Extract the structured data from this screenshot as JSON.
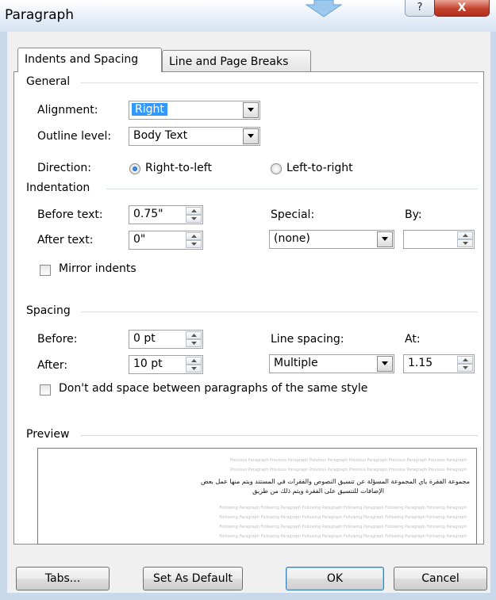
{
  "window": {
    "title": "Paragraph",
    "help_glyph": "?",
    "close_glyph": "X"
  },
  "tabs": [
    {
      "label": "Indents and Spacing",
      "mnemonic": "I",
      "active": true
    },
    {
      "label": "Line and Page Breaks",
      "mnemonic": "P",
      "active": false
    }
  ],
  "general": {
    "title": "General",
    "alignment": {
      "label": "Alignment:",
      "value": "Right"
    },
    "outline": {
      "label": "Outline level:",
      "value": "Body Text"
    },
    "direction": {
      "label": "Direction:",
      "options": [
        {
          "label": "Right-to-left",
          "selected": true
        },
        {
          "label": "Left-to-right",
          "selected": false
        }
      ]
    }
  },
  "indentation": {
    "title": "Indentation",
    "before_text": {
      "label": "Before text:",
      "value": "0.75\""
    },
    "after_text": {
      "label": "After text:",
      "value": "0\""
    },
    "special": {
      "label": "Special:",
      "value": "(none)"
    },
    "by": {
      "label": "By:",
      "value": ""
    },
    "mirror": {
      "label": "Mirror indents",
      "checked": false
    }
  },
  "spacing": {
    "title": "Spacing",
    "before": {
      "label": "Before:",
      "value": "0 pt"
    },
    "after": {
      "label": "After:",
      "value": "10 pt"
    },
    "line_spacing": {
      "label": "Line spacing:",
      "value": "Multiple"
    },
    "at": {
      "label": "At:",
      "value": "1.15"
    },
    "dont_add": {
      "label": "Don't add space between paragraphs of the same style",
      "checked": false
    }
  },
  "preview": {
    "title": "Preview",
    "sample_gray": "Previous Paragraph Previous Paragraph Previous Paragraph Previous Paragraph Previous Paragraph Previous Paragraph",
    "sample_arabic_1": "مجموعة الفقرة ياي المجموعة المسؤلة عن تنسيق النصوص والفقرات في المستند ويتم منها عمل بعض",
    "sample_arabic_2": "الإضافات للتنسيق على الفقرة ويتم ذلك من طريق",
    "sample_following": "Following Paragraph Following Paragraph Following Paragraph Following Paragraph Following Paragraph Following Paragraph"
  },
  "buttons": {
    "tabs": "Tabs...",
    "set_default": "Set As Default",
    "ok": "OK",
    "cancel": "Cancel"
  },
  "colors": {
    "accent_selection": "#3399ff",
    "close": "#c4432e",
    "frame": "#c9d8eb"
  }
}
